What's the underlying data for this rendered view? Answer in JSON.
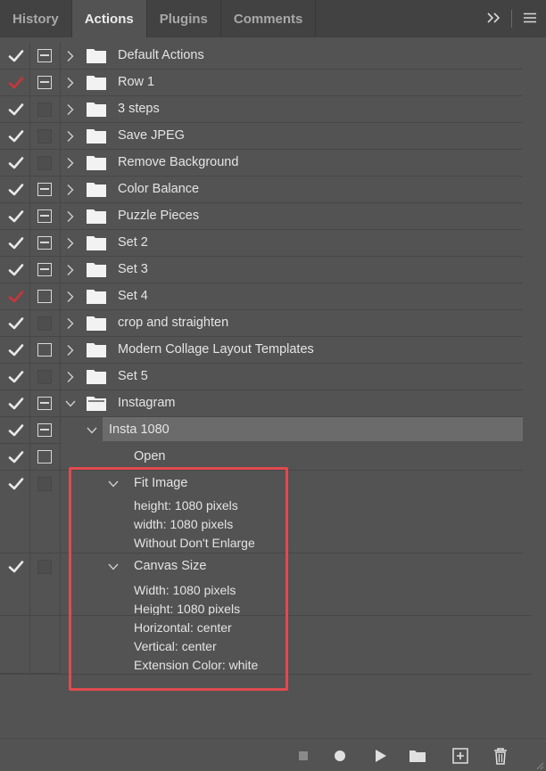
{
  "tabs": [
    {
      "label": "History"
    },
    {
      "label": "Actions"
    },
    {
      "label": "Plugins"
    },
    {
      "label": "Comments"
    }
  ],
  "panel_menu_icons": [
    "expand-icon",
    "menu-icon"
  ],
  "colors": {
    "panel_bg": "#535353",
    "tab_bg": "#424242",
    "check_red": "#c8363b",
    "highlight_border": "#e04a4f",
    "selected_row": "#6b6b6b"
  },
  "actions": [
    {
      "label": "Default Actions",
      "check": "white",
      "dialog": "minus",
      "expanded": false
    },
    {
      "label": "Row 1",
      "check": "red",
      "dialog": "minus",
      "expanded": false
    },
    {
      "label": "3 steps",
      "check": "white",
      "dialog": "none",
      "expanded": false
    },
    {
      "label": "Save JPEG",
      "check": "white",
      "dialog": "none",
      "expanded": false
    },
    {
      "label": "Remove Background",
      "check": "white",
      "dialog": "none",
      "expanded": false
    },
    {
      "label": "Color Balance",
      "check": "white",
      "dialog": "minus",
      "expanded": false
    },
    {
      "label": "Puzzle Pieces",
      "check": "white",
      "dialog": "minus",
      "expanded": false
    },
    {
      "label": "Set 2",
      "check": "white",
      "dialog": "minus",
      "expanded": false
    },
    {
      "label": "Set 3",
      "check": "white",
      "dialog": "minus",
      "expanded": false
    },
    {
      "label": "Set 4",
      "check": "red",
      "dialog": "box",
      "expanded": false
    },
    {
      "label": "crop and straighten",
      "check": "white",
      "dialog": "none",
      "expanded": false
    },
    {
      "label": "Modern Collage Layout Templates",
      "check": "white",
      "dialog": "box",
      "expanded": false
    },
    {
      "label": "Set 5",
      "check": "white",
      "dialog": "none",
      "expanded": false
    },
    {
      "label": "Instagram",
      "check": "white",
      "dialog": "minus",
      "expanded": true
    }
  ],
  "instagram_action": {
    "label": "Insta 1080",
    "check": "white",
    "dialog": "minus"
  },
  "steps": {
    "open": {
      "label": "Open"
    },
    "fit_image": {
      "label": "Fit Image",
      "details": [
        "height: 1080 pixels",
        "width: 1080 pixels",
        "Without Don't Enlarge"
      ]
    },
    "canvas_size": {
      "label": "Canvas Size",
      "details": [
        "Width: 1080 pixels",
        "Height: 1080 pixels",
        "Horizontal: center",
        "Vertical: center",
        "Extension Color: white"
      ]
    }
  },
  "bottom_toolbar": [
    "stop-icon",
    "record-icon",
    "play-icon",
    "new-set-folder-icon",
    "new-action-icon",
    "delete-icon"
  ]
}
